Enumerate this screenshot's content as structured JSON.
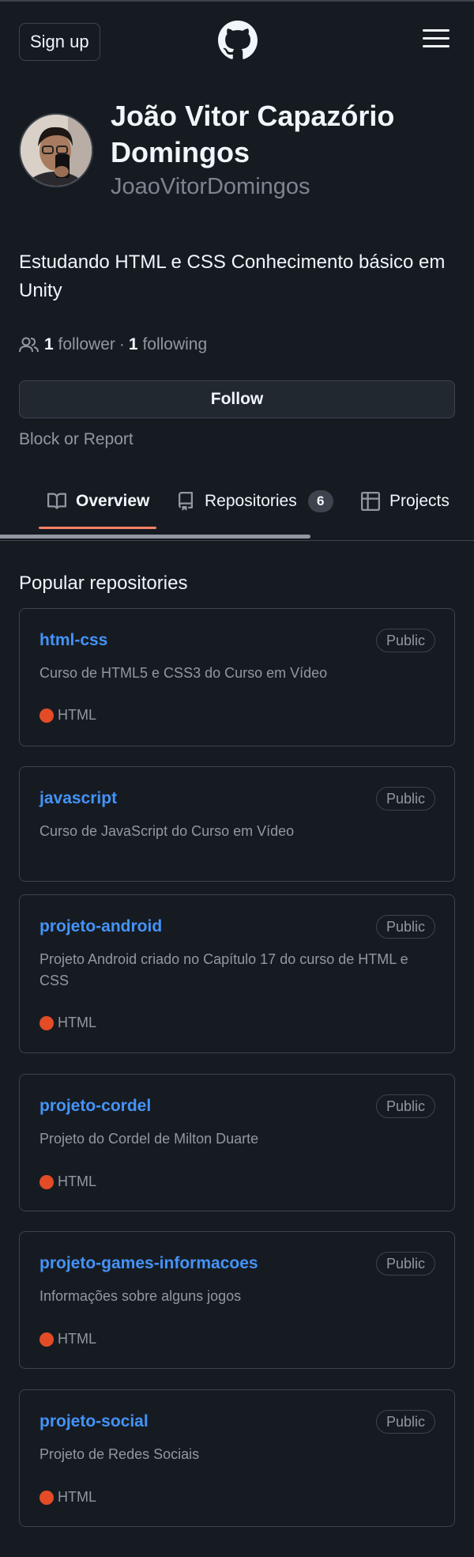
{
  "header": {
    "signup_label": "Sign up",
    "logo_icon": "github-icon",
    "menu_icon": "hamburger-menu-icon"
  },
  "profile": {
    "full_name": "João Vitor Capazório Domingos",
    "username": "JoaoVitorDomingos",
    "bio": "Estudando HTML e CSS Conhecimento básico em Unity",
    "followers_count": "1",
    "followers_label": "follower",
    "separator": "·",
    "following_count": "1",
    "following_label": "following",
    "follow_button": "Follow",
    "block_label": "Block or Report"
  },
  "tabs": [
    {
      "label": "Overview",
      "icon": "book-icon",
      "selected": true
    },
    {
      "label": "Repositories",
      "icon": "repo-icon",
      "counter": "6"
    },
    {
      "label": "Projects",
      "icon": "table-icon"
    }
  ],
  "popular": {
    "title": "Popular repositories",
    "repos": [
      {
        "name": "html-css",
        "visibility": "Public",
        "description": "Curso de HTML5 e CSS3 do Curso em Vídeo",
        "language": "HTML"
      },
      {
        "name": "javascript",
        "visibility": "Public",
        "description": "Curso de JavaScript do Curso em Vídeo",
        "language": ""
      },
      {
        "name": "projeto-android",
        "visibility": "Public",
        "description": "Projeto Android criado no Capítulo 17 do curso de HTML e CSS",
        "language": "HTML"
      },
      {
        "name": "projeto-cordel",
        "visibility": "Public",
        "description": "Projeto do Cordel de Milton Duarte",
        "language": "HTML"
      },
      {
        "name": "projeto-games-informacoes",
        "visibility": "Public",
        "description": "Informações sobre alguns jogos",
        "language": "HTML"
      },
      {
        "name": "projeto-social",
        "visibility": "Public",
        "description": "Projeto de Redes Sociais",
        "language": "HTML"
      }
    ]
  },
  "colors": {
    "background": "#161b22",
    "link": "#4493f8",
    "muted": "#9198a1",
    "html_language": "#e34c26",
    "tab_accent": "#f78166"
  }
}
